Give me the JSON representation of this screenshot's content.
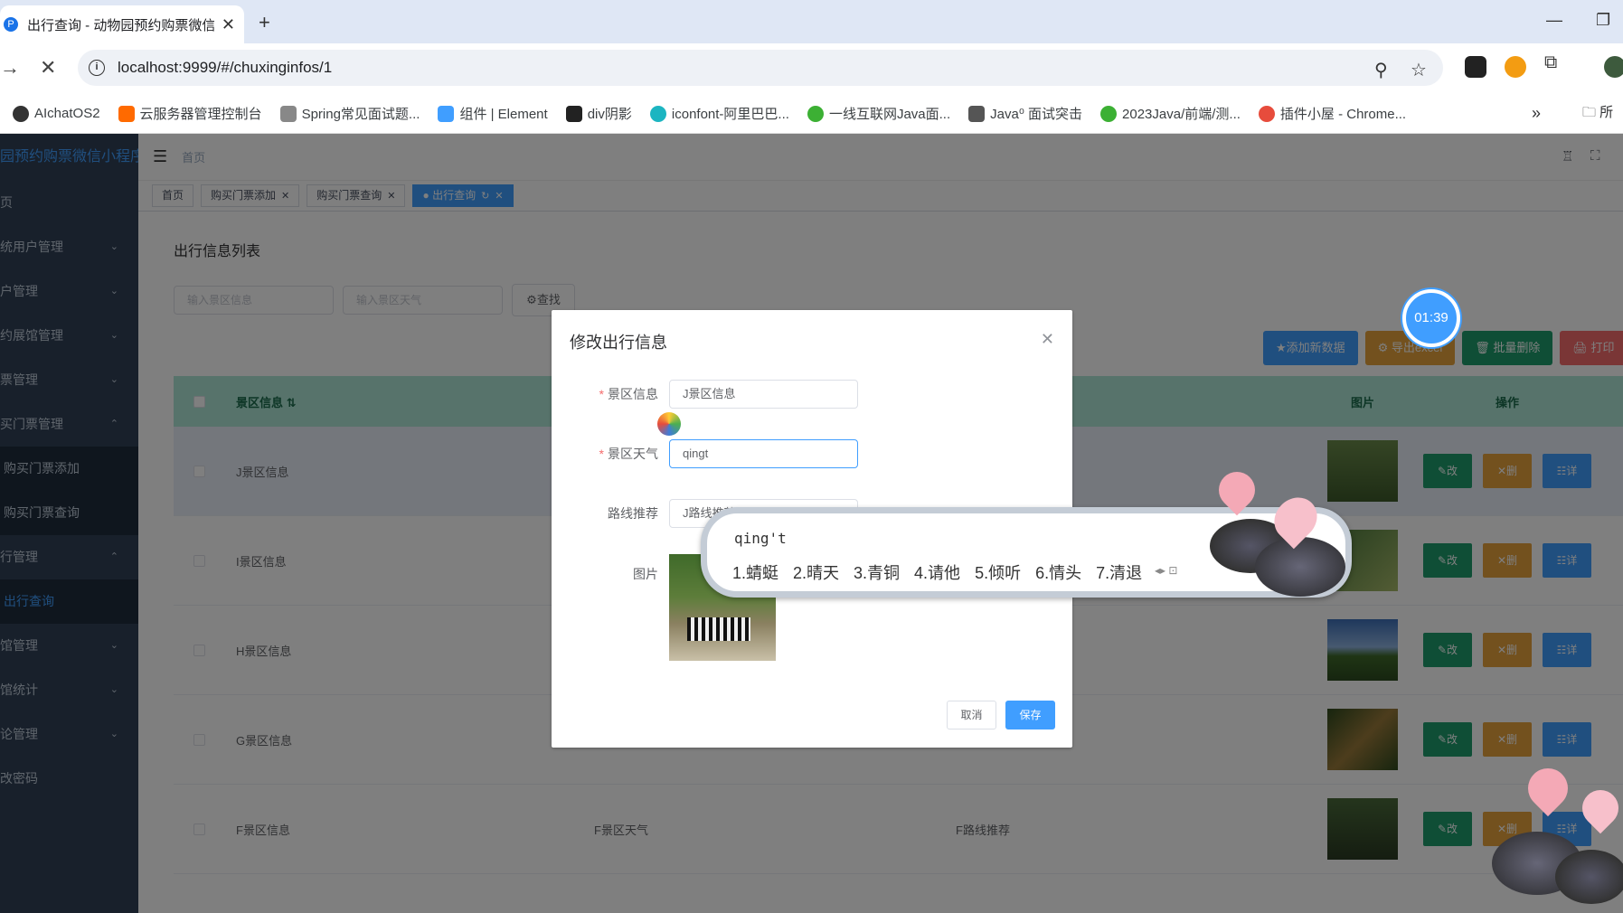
{
  "browser": {
    "tab_title": "出行查询 - 动物园预约购票微信",
    "url": "localhost:9999/#/chuxinginfos/1",
    "bookmarks": [
      {
        "label": "AIchatOS2",
        "color": "#333333"
      },
      {
        "label": "云服务器管理控制台",
        "color": "#ff6a00"
      },
      {
        "label": "Spring常见面试题...",
        "color": "#555555"
      },
      {
        "label": "组件 | Element",
        "color": "#409eff"
      },
      {
        "label": "div阴影",
        "color": "#222222"
      },
      {
        "label": "iconfont-阿里巴巴...",
        "color": "#1cb5c1"
      },
      {
        "label": "一线互联网Java面...",
        "color": "#3cb034"
      },
      {
        "label": "Java⁰ 面试突击",
        "color": "#444444"
      },
      {
        "label": "2023Java/前端/测...",
        "color": "#3cb034"
      },
      {
        "label": "插件小屋 - Chrome...",
        "color": "#e74c3c"
      }
    ],
    "bookmarks_more": "»",
    "bookmarks_folder": "所"
  },
  "sidebar": {
    "title": "园预约购票微信小程序",
    "items": [
      {
        "label": "页",
        "arrow": ""
      },
      {
        "label": "统用户管理",
        "arrow": "⌄"
      },
      {
        "label": "户管理",
        "arrow": "⌄"
      },
      {
        "label": "约展馆管理",
        "arrow": "⌄"
      },
      {
        "label": "票管理",
        "arrow": "⌄"
      },
      {
        "label": "买门票管理",
        "arrow": "⌃"
      },
      {
        "label": "购买门票添加",
        "arrow": ""
      },
      {
        "label": "购买门票查询",
        "arrow": ""
      },
      {
        "label": "行管理",
        "arrow": "⌃"
      },
      {
        "label": "出行查询",
        "arrow": ""
      },
      {
        "label": "馆管理",
        "arrow": "⌄"
      },
      {
        "label": "馆统计",
        "arrow": "⌄"
      },
      {
        "label": "论管理",
        "arrow": "⌄"
      },
      {
        "label": "改密码",
        "arrow": ""
      }
    ]
  },
  "navbar": {
    "breadcrumb": "首页"
  },
  "tags": [
    {
      "label": "首页",
      "closable": false
    },
    {
      "label": "购买门票添加",
      "closable": true
    },
    {
      "label": "购买门票查询",
      "closable": true
    },
    {
      "label": "出行查询",
      "closable": true
    }
  ],
  "page": {
    "title": "出行信息列表",
    "search": {
      "placeholder_1": "输入景区信息",
      "placeholder_2": "输入景区天气",
      "button": "查找"
    },
    "actions": [
      {
        "label": "★添加新数据",
        "color": "#409eff"
      },
      {
        "label": "⚙ 导出excel",
        "color": "#e6a23c"
      },
      {
        "label": "🗑 批量删除",
        "color": "#1e9d6c"
      },
      {
        "label": "🖨 打印",
        "color": "#f56c6c"
      }
    ],
    "table": {
      "headers": [
        "景区信息 ⇅",
        "",
        "",
        "图片",
        "操作"
      ],
      "rows": [
        {
          "info": "J景区信息",
          "weather": "",
          "route": "",
          "hl": true
        },
        {
          "info": "I景区信息",
          "weather": "",
          "route": ""
        },
        {
          "info": "H景区信息",
          "weather": "",
          "route": ""
        },
        {
          "info": "G景区信息",
          "weather": "",
          "route": ""
        },
        {
          "info": "F景区信息",
          "weather": "F景区天气",
          "route": "F路线推荐"
        }
      ],
      "ops": {
        "edit": "✎改",
        "delete": "✕删",
        "detail": "☷详"
      },
      "op_colors": {
        "edit": "#1e9d6c",
        "delete": "#e6a23c",
        "detail": "#409eff"
      }
    }
  },
  "modal": {
    "title": "修改出行信息",
    "fields": [
      {
        "label": "景区信息",
        "required": true,
        "value": "J景区信息"
      },
      {
        "label": "景区天气",
        "required": true,
        "value": "qingt"
      },
      {
        "label": "路线推荐",
        "required": false,
        "value": "J路线推荐"
      }
    ],
    "image_label": "图片",
    "cancel": "取消",
    "save": "保存"
  },
  "ime": {
    "pinyin": "qing't",
    "candidates": [
      "1.蜻蜓",
      "2.晴天",
      "3.青铜",
      "4.请他",
      "5.倾听",
      "6.情头",
      "7.清退"
    ]
  },
  "timer": "01:39"
}
